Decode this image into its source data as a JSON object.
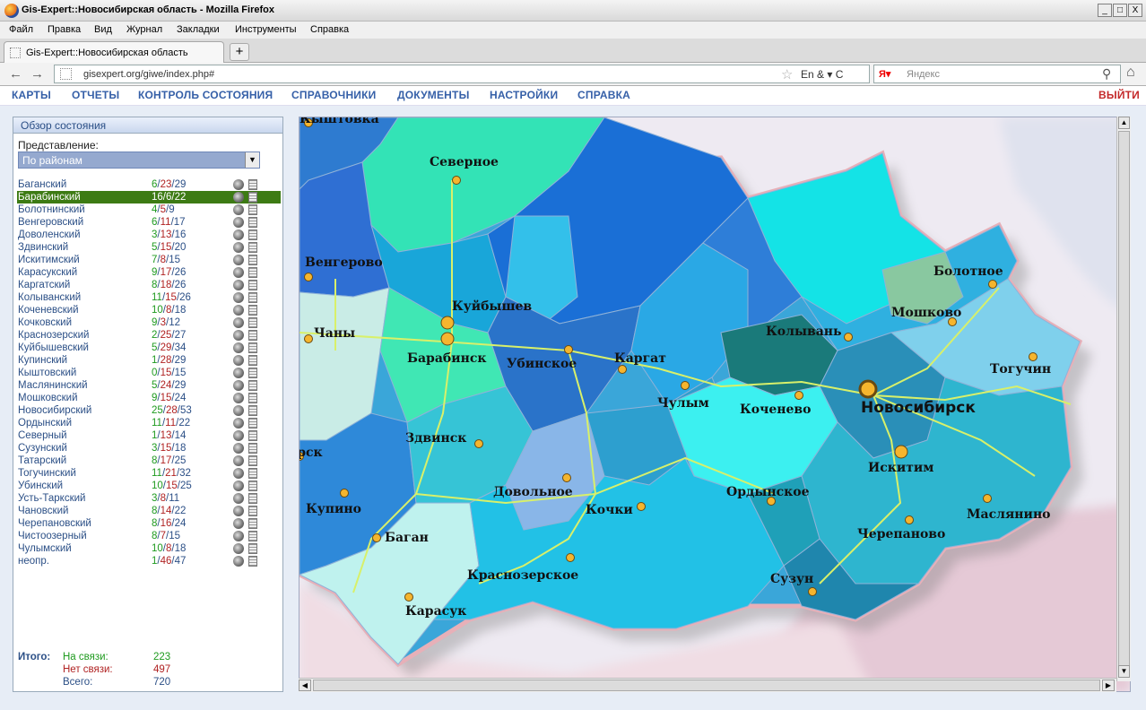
{
  "window": {
    "title": "Gis-Expert::Новосибирская область - Mozilla Firefox",
    "controls": [
      "_",
      "□",
      "X"
    ]
  },
  "menu": [
    "Файл",
    "Правка",
    "Вид",
    "Журнал",
    "Закладки",
    "Инструменты",
    "Справка"
  ],
  "tab": {
    "title": "Gis-Expert::Новосибирская область",
    "new_tab": "+"
  },
  "nav": {
    "back": "←",
    "forward": "→",
    "url": "gisexpert.org/giwe/index.php#",
    "url_icons": "En & ▾ C",
    "search_engine": "Я▾",
    "search_placeholder": "Яндекс"
  },
  "app_nav": {
    "items": [
      "КАРТЫ",
      "ОТЧЕТЫ",
      "КОНТРОЛЬ СОСТОЯНИЯ",
      "СПРАВОЧНИКИ",
      "ДОКУМЕНТЫ",
      "НАСТРОЙКИ",
      "СПРАВКА"
    ],
    "logout": "ВЫЙТИ"
  },
  "panel": {
    "title": "Обзор состояния",
    "view_label": "Представление:",
    "view_value": "По районам"
  },
  "districts": [
    {
      "name": "Баганский",
      "a": "6",
      "b": "23",
      "c": "29"
    },
    {
      "name": "Барабинский",
      "a": "16",
      "b": "6",
      "c": "22",
      "selected": true
    },
    {
      "name": "Болотнинский",
      "a": "4",
      "b": "5",
      "c": "9"
    },
    {
      "name": "Венгеровский",
      "a": "6",
      "b": "11",
      "c": "17"
    },
    {
      "name": "Доволенский",
      "a": "3",
      "b": "13",
      "c": "16"
    },
    {
      "name": "Здвинский",
      "a": "5",
      "b": "15",
      "c": "20"
    },
    {
      "name": "Искитимский",
      "a": "7",
      "b": "8",
      "c": "15"
    },
    {
      "name": "Карасукский",
      "a": "9",
      "b": "17",
      "c": "26"
    },
    {
      "name": "Каргатский",
      "a": "8",
      "b": "18",
      "c": "26"
    },
    {
      "name": "Колыванский",
      "a": "11",
      "b": "15",
      "c": "26"
    },
    {
      "name": "Коченевский",
      "a": "10",
      "b": "8",
      "c": "18"
    },
    {
      "name": "Кочковский",
      "a": "9",
      "b": "3",
      "c": "12"
    },
    {
      "name": "Краснозерский",
      "a": "2",
      "b": "25",
      "c": "27"
    },
    {
      "name": "Куйбышевский",
      "a": "5",
      "b": "29",
      "c": "34"
    },
    {
      "name": "Купинский",
      "a": "1",
      "b": "28",
      "c": "29"
    },
    {
      "name": "Кыштовский",
      "a": "0",
      "b": "15",
      "c": "15"
    },
    {
      "name": "Маслянинский",
      "a": "5",
      "b": "24",
      "c": "29"
    },
    {
      "name": "Мошковский",
      "a": "9",
      "b": "15",
      "c": "24"
    },
    {
      "name": "Новосибирский",
      "a": "25",
      "b": "28",
      "c": "53"
    },
    {
      "name": "Ордынский",
      "a": "11",
      "b": "11",
      "c": "22"
    },
    {
      "name": "Северный",
      "a": "1",
      "b": "13",
      "c": "14"
    },
    {
      "name": "Сузунский",
      "a": "3",
      "b": "15",
      "c": "18"
    },
    {
      "name": "Татарский",
      "a": "8",
      "b": "17",
      "c": "25"
    },
    {
      "name": "Тогучинский",
      "a": "11",
      "b": "21",
      "c": "32"
    },
    {
      "name": "Убинский",
      "a": "10",
      "b": "15",
      "c": "25"
    },
    {
      "name": "Усть-Таркский",
      "a": "3",
      "b": "8",
      "c": "11"
    },
    {
      "name": "Чановский",
      "a": "8",
      "b": "14",
      "c": "22"
    },
    {
      "name": "Черепановский",
      "a": "8",
      "b": "16",
      "c": "24"
    },
    {
      "name": "Чистоозерный",
      "a": "8",
      "b": "7",
      "c": "15"
    },
    {
      "name": "Чулымский",
      "a": "10",
      "b": "8",
      "c": "18"
    },
    {
      "name": "неопр.",
      "a": "1",
      "b": "46",
      "c": "47"
    }
  ],
  "totals": {
    "label": "Итого:",
    "online_label": "На связи:",
    "online": "223",
    "offline_label": "Нет связи:",
    "offline": "497",
    "total_label": "Всего:",
    "total": "720"
  },
  "map": {
    "cities": [
      {
        "name": "Кыштовка"
      },
      {
        "name": "Северное"
      },
      {
        "name": "Венгерово"
      },
      {
        "name": "Куйбышев"
      },
      {
        "name": "Чаны"
      },
      {
        "name": "Барабинск"
      },
      {
        "name": "Убинское"
      },
      {
        "name": "Каргат"
      },
      {
        "name": "Колывань"
      },
      {
        "name": "Болотное"
      },
      {
        "name": "Мошково"
      },
      {
        "name": "Тогучин"
      },
      {
        "name": "Чулым"
      },
      {
        "name": "Коченево"
      },
      {
        "name": "Новосибирск"
      },
      {
        "name": "Здвинск"
      },
      {
        "name": "Искитим"
      },
      {
        "name": "Довольное"
      },
      {
        "name": "Кочки"
      },
      {
        "name": "Ордынское"
      },
      {
        "name": "Купино"
      },
      {
        "name": "Маслянино"
      },
      {
        "name": "Черепаново"
      },
      {
        "name": "Баган"
      },
      {
        "name": "Краснозерское"
      },
      {
        "name": "Сузун"
      },
      {
        "name": "Карасук"
      },
      {
        "name": "Татарск"
      }
    ]
  },
  "colors": {
    "nav_blue": "#3660a8",
    "logout_red": "#c4292a",
    "selected_row": "#3d7b14",
    "online_green": "#1e9a1e",
    "offline_red": "#b02222"
  }
}
